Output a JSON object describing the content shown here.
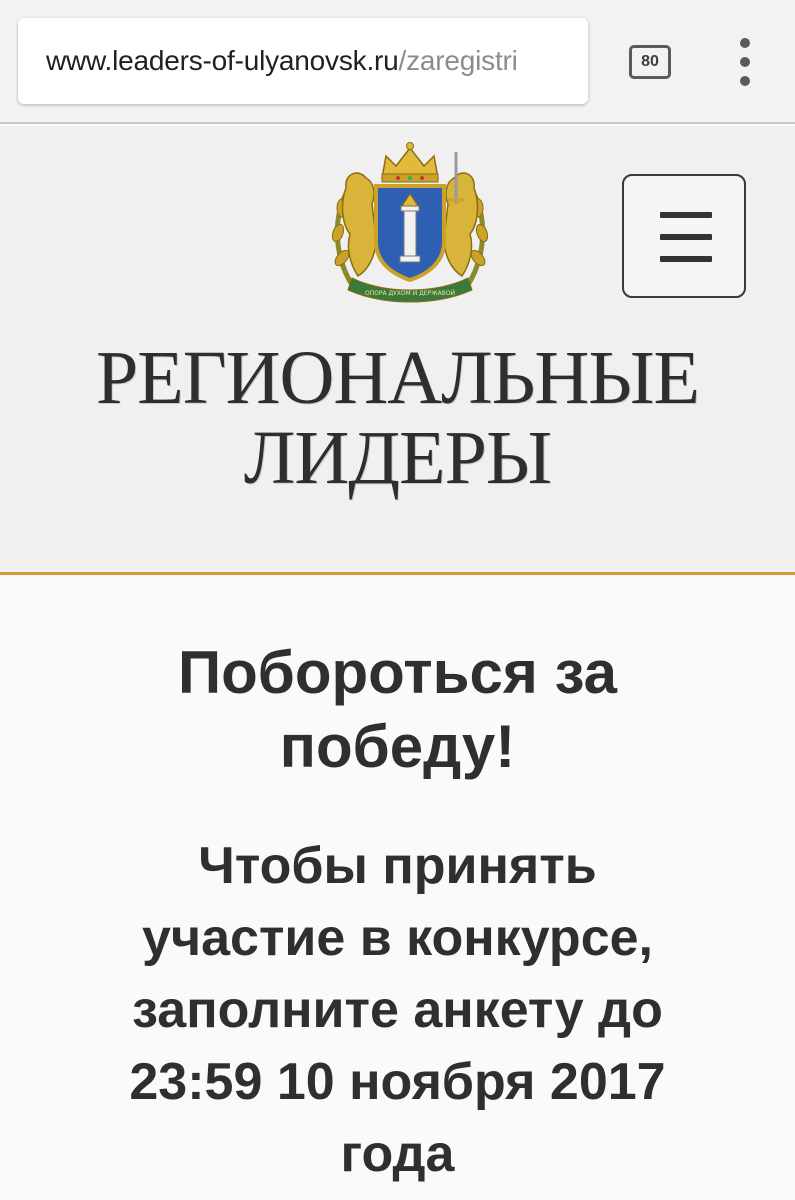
{
  "browser": {
    "url_domain": "www.leaders-of-ulyanovsk.ru",
    "url_path": "/zaregistri",
    "tab_count": "80",
    "menu_icon": "more-vert-icon"
  },
  "header": {
    "logo_icon": "ulyanovsk-coat-of-arms-icon",
    "logo_motto": "ОПОРА ДУХОМ И ДЕРЖАВОЙ",
    "menu_icon": "hamburger-icon",
    "title_line1": "РЕГИОНАЛЬНЫЕ",
    "title_line2": "ЛИДЕРЫ",
    "accent_color": "#d39c3a"
  },
  "main": {
    "heading_line1": "Побороться за",
    "heading_line2": "победу!",
    "subheading_lines": [
      "Чтобы принять",
      "участие в конкурсе,",
      "заполните анкету до",
      "23:59 10 ноября 2017",
      "года"
    ]
  }
}
